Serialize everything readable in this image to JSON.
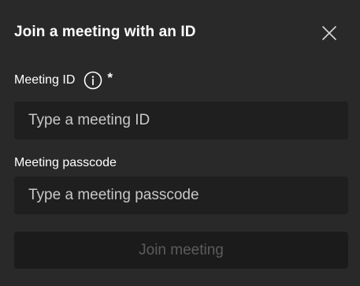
{
  "dialog": {
    "title": "Join a meeting with an ID"
  },
  "meeting_id": {
    "label": "Meeting ID",
    "required_marker": "*",
    "placeholder": "Type a meeting ID",
    "value": ""
  },
  "passcode": {
    "label": "Meeting passcode",
    "placeholder": "Type a meeting passcode",
    "value": ""
  },
  "actions": {
    "join_label": "Join meeting",
    "join_enabled": false
  },
  "icons": {
    "close": "close-icon",
    "info": "info-icon"
  },
  "colors": {
    "background": "#292929",
    "input_background": "#1f1f1f",
    "button_disabled_background": "#1b1b1b",
    "button_disabled_text": "#5c5c5c"
  }
}
